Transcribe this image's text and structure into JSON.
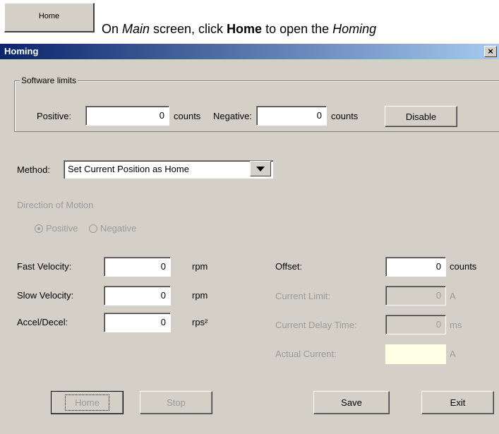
{
  "top": {
    "home_button_label": "Home",
    "instruction_prefix": "On ",
    "instruction_main": "Main",
    "instruction_mid": " screen, click ",
    "instruction_home": "Home",
    "instruction_suffix": " to open the ",
    "instruction_homing": "Homing"
  },
  "window": {
    "title": "Homing",
    "close_glyph": "×"
  },
  "software_limits": {
    "group_label": "Software limits",
    "positive_label": "Positive:",
    "positive_value": "0",
    "positive_unit": "counts",
    "negative_label": "Negative:",
    "negative_value": "0",
    "negative_unit": "counts",
    "disable_label": "Disable"
  },
  "method": {
    "label": "Method:",
    "selected": "Set Current Position as Home"
  },
  "direction": {
    "label": "Direction of Motion",
    "positive": "Positive",
    "negative": "Negative",
    "selected": "Positive"
  },
  "left_fields": [
    {
      "label": "Fast Velocity:",
      "value": "0",
      "unit": "rpm"
    },
    {
      "label": "Slow Velocity:",
      "value": "0",
      "unit": "rpm"
    },
    {
      "label": "Accel/Decel:",
      "value": "0",
      "unit": "rps²"
    }
  ],
  "right_fields": [
    {
      "label": "Offset:",
      "value": "0",
      "unit": "counts"
    },
    {
      "label": "Current Limit:",
      "value": "0",
      "unit": "A"
    },
    {
      "label": "Current Delay Time:",
      "value": "0",
      "unit": "ms"
    },
    {
      "label": "Actual Current:",
      "value": "",
      "unit": "A"
    }
  ],
  "buttons": {
    "home": "Home",
    "stop": "Stop",
    "save": "Save",
    "exit": "Exit"
  },
  "colors": {
    "title_gradient_start": "#0a246a",
    "title_gradient_end": "#a6caf0",
    "window_bg": "#d4d0c8",
    "actual_current_bg": "#ffffe6"
  }
}
